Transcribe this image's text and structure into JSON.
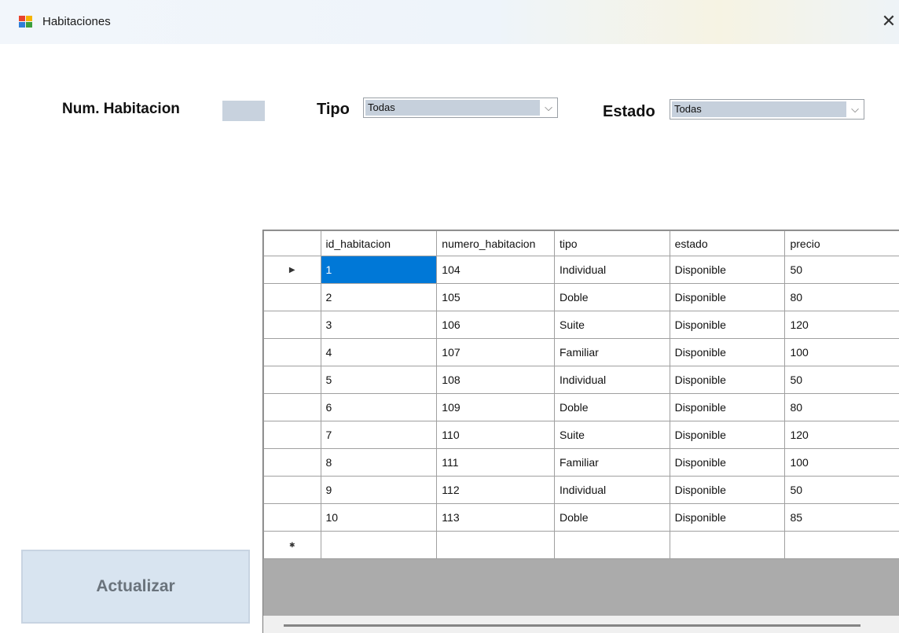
{
  "window": {
    "title": "Habitaciones",
    "close_glyph": "✕",
    "icon": "app-window-icon"
  },
  "filters": {
    "num_label": "Num. Habitacion",
    "num_value": "",
    "tipo_label": "Tipo",
    "tipo_value": "Todas",
    "estado_label": "Estado",
    "estado_value": "Todas",
    "arrow_glyph": "⌵"
  },
  "actions": {
    "refresh_label": "Actualizar"
  },
  "grid": {
    "columns": [
      "id_habitacion",
      "numero_habitacion",
      "tipo",
      "estado",
      "precio"
    ],
    "current_row_glyph": "▶",
    "new_row_glyph": "✱",
    "rows": [
      [
        "1",
        "104",
        "Individual",
        "Disponible",
        "50"
      ],
      [
        "2",
        "105",
        "Doble",
        "Disponible",
        "80"
      ],
      [
        "3",
        "106",
        "Suite",
        "Disponible",
        "120"
      ],
      [
        "4",
        "107",
        "Familiar",
        "Disponible",
        "100"
      ],
      [
        "5",
        "108",
        "Individual",
        "Disponible",
        "50"
      ],
      [
        "6",
        "109",
        "Doble",
        "Disponible",
        "80"
      ],
      [
        "7",
        "110",
        "Suite",
        "Disponible",
        "120"
      ],
      [
        "8",
        "111",
        "Familiar",
        "Disponible",
        "100"
      ],
      [
        "9",
        "112",
        "Individual",
        "Disponible",
        "50"
      ],
      [
        "10",
        "113",
        "Doble",
        "Disponible",
        "85"
      ]
    ]
  },
  "colors": {
    "selection": "#0078d7",
    "input_fill": "#c8d2de",
    "button_fill": "#d8e4f0",
    "grid_background": "#ababab"
  }
}
